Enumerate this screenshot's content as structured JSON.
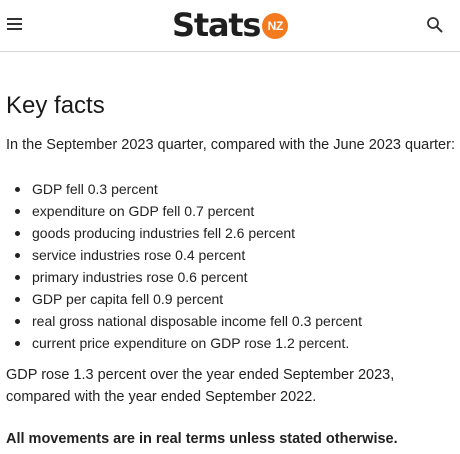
{
  "header": {
    "menu_icon": "hamburger-menu-icon",
    "logo": {
      "word": "Stats",
      "badge": "NZ",
      "badge_color": "#f47a20"
    },
    "search_icon": "search-icon"
  },
  "main": {
    "heading": "Key facts",
    "intro": "In the September 2023 quarter, compared with the June 2023 quarter:",
    "facts": [
      "GDP fell 0.3 percent",
      "expenditure on GDP fell 0.7 percent",
      "goods producing industries fell 2.6 percent",
      "service industries rose 0.4 percent",
      "primary industries rose 0.6 percent",
      "GDP per capita fell 0.9 percent",
      "real gross national disposable income fell 0.3 percent",
      "current price expenditure on GDP rose 1.2 percent."
    ],
    "summary": "GDP rose 1.3 percent over the year ended September 2023, compared with the year ended September 2022.",
    "note": "All movements are in real terms unless stated otherwise."
  }
}
